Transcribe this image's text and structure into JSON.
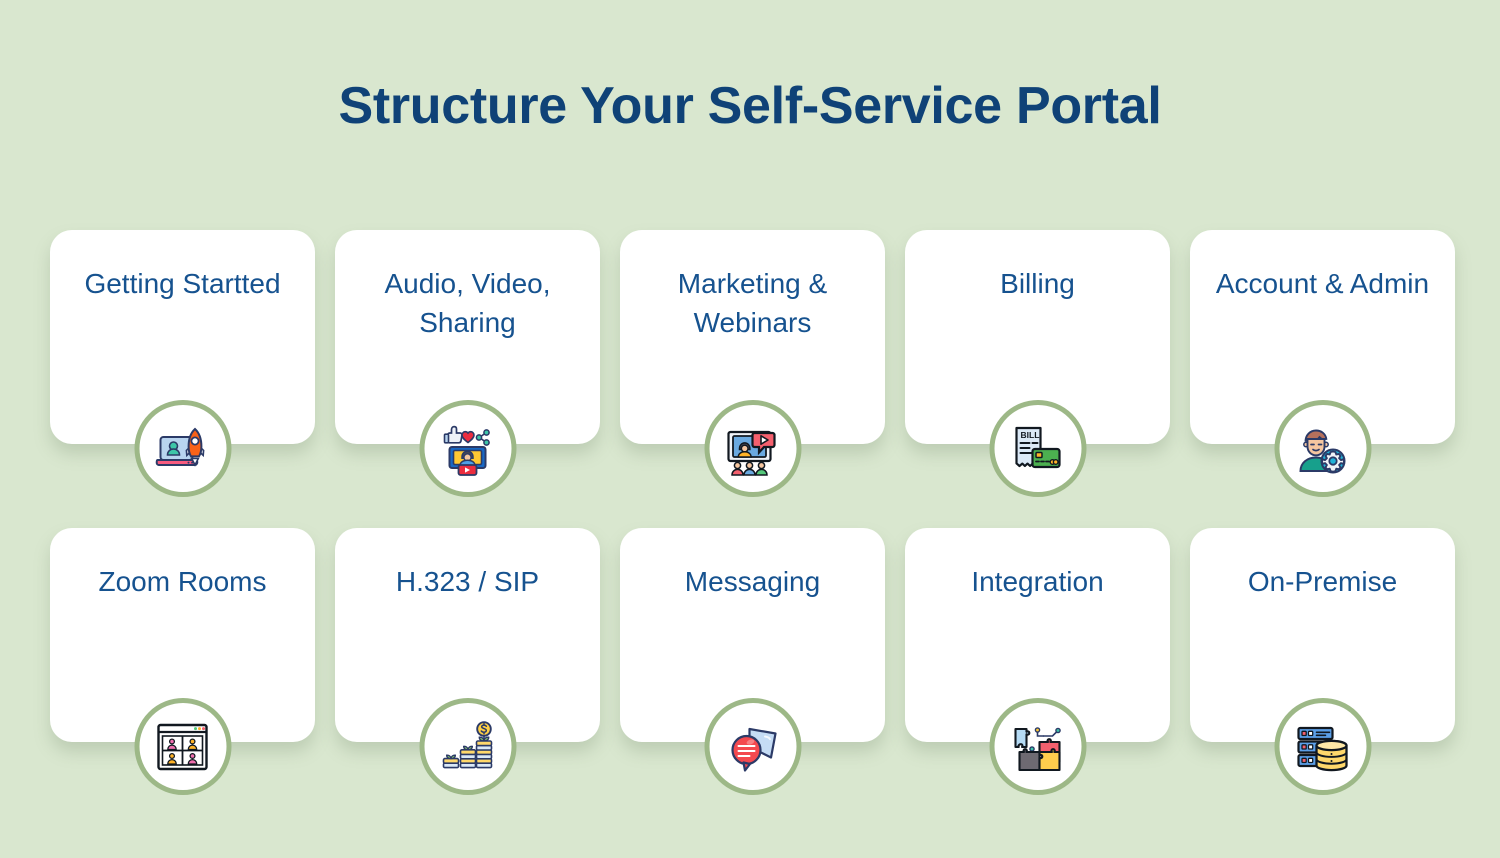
{
  "page": {
    "title": "Structure Your Self-Service Portal",
    "background_color": "#d9e7cf",
    "title_color": "#0f4277",
    "card_color": "#ffffff",
    "label_color": "#16528f",
    "circle_border_color": "#9db887"
  },
  "rows": [
    {
      "cards": [
        {
          "label": "Getting Startted",
          "icon": "laptop-rocket-icon"
        },
        {
          "label": "Audio, Video, Sharing",
          "icon": "video-social-share-icon"
        },
        {
          "label": "Marketing & Webinars",
          "icon": "webinar-presentation-icon"
        },
        {
          "label": "Billing",
          "icon": "bill-credit-card-icon"
        },
        {
          "label": "Account & Admin",
          "icon": "user-gear-icon"
        }
      ]
    },
    {
      "cards": [
        {
          "label": "Zoom Rooms",
          "icon": "video-grid-window-icon"
        },
        {
          "label": "H.323 / SIP",
          "icon": "coin-stack-growth-icon"
        },
        {
          "label": "Messaging",
          "icon": "chat-bubbles-icon"
        },
        {
          "label": "Integration",
          "icon": "puzzle-pieces-icon"
        },
        {
          "label": "On-Premise",
          "icon": "server-database-icon"
        }
      ]
    }
  ],
  "icon_text": {
    "bill": "BILL"
  }
}
